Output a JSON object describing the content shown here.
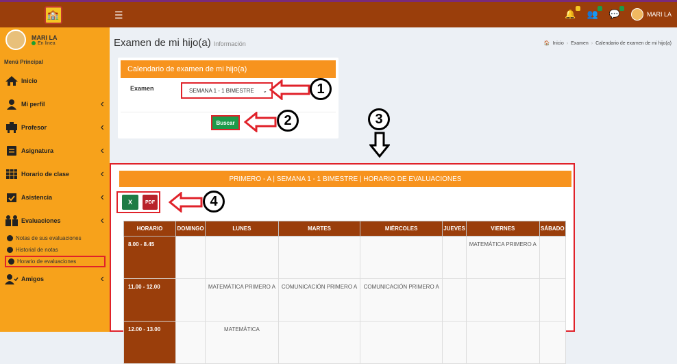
{
  "topbar": {
    "user_name": "MARI LA"
  },
  "sidebar": {
    "user_name": "MARI LA",
    "user_status": "En línea",
    "menu_header": "Menú Principal",
    "items": [
      {
        "label": "Inicio"
      },
      {
        "label": "Mi perfil"
      },
      {
        "label": "Profesor"
      },
      {
        "label": "Asignatura"
      },
      {
        "label": "Horario de clase"
      },
      {
        "label": "Asistencia"
      },
      {
        "label": "Evaluaciones"
      },
      {
        "label": "Amigos"
      }
    ],
    "sub_items": [
      {
        "label": "Notas de sus evaluaciones"
      },
      {
        "label": "Historial de notas"
      },
      {
        "label": "Horario de evaluaciones"
      }
    ]
  },
  "page": {
    "title": "Examen de mi hijo(a)",
    "subtitle": "Información",
    "breadcrumb": [
      "Inicio",
      "Examen",
      "Calendario de examen de mi hijo(a)"
    ]
  },
  "filter_panel": {
    "header": "Calendario de examen de mi hijo(a)",
    "label": "Examen",
    "select_value": "SEMANA 1 - 1 BIMESTRE",
    "button": "Buscar"
  },
  "schedule": {
    "header": "PRIMERO - A | SEMANA 1 - 1 BIMESTRE | HORARIO DE EVALUACIONES",
    "export_excel": "X",
    "export_pdf": "PDF",
    "columns": [
      "HORARIO",
      "DOMINGO",
      "LUNES",
      "MARTES",
      "MIÉRCOLES",
      "JUEVES",
      "VIERNES",
      "SÁBADO"
    ],
    "rows": [
      {
        "hour": "8.00 - 8.45",
        "cells": [
          "",
          "",
          "",
          "",
          "",
          "MATEMÁTICA PRIMERO A",
          ""
        ]
      },
      {
        "hour": "11.00 - 12.00",
        "cells": [
          "",
          "MATEMÁTICA PRIMERO A",
          "COMUNICACIÓN PRIMERO A",
          "COMUNICACIÓN PRIMERO A",
          "",
          "",
          ""
        ]
      },
      {
        "hour": "12.00 - 13.00",
        "cells": [
          "",
          "MATEMÁTICA",
          "",
          "",
          "",
          "",
          ""
        ]
      }
    ]
  },
  "annotations": [
    "1",
    "2",
    "3",
    "4"
  ]
}
